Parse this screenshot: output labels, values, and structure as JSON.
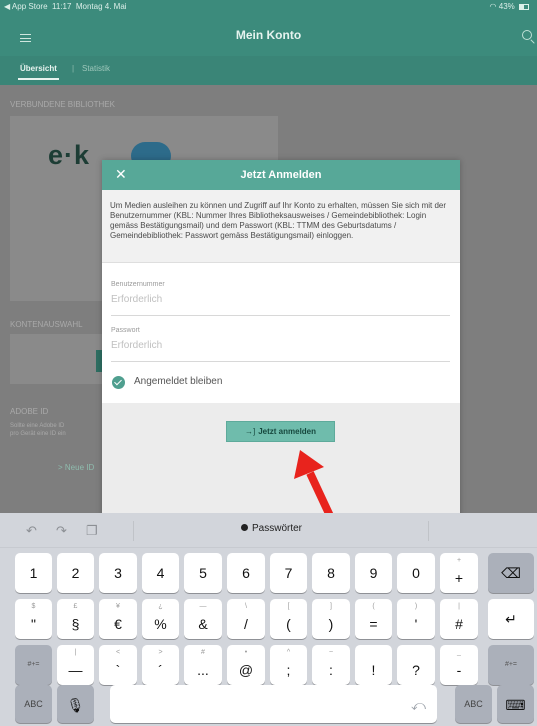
{
  "status": {
    "back_app": "◀ App Store",
    "time": "11:17",
    "date": "Montag 4. Mai",
    "battery": "43%"
  },
  "nav": {
    "title": "Mein Konto"
  },
  "tabs": [
    {
      "label": "Übersicht"
    },
    {
      "label": "Statistik"
    }
  ],
  "background": {
    "section_library": "VERBUNDENE BIBLIOTHEK",
    "logo_text": "e·k",
    "section_account": "KONTENAUSWAHL",
    "section_adobe": "ADOBE ID",
    "adobe_text_1": "Sollte eine Adobe ID",
    "adobe_text_2": "pro Gerät eine ID ein",
    "new_id_link": "> Neue ID"
  },
  "dialog": {
    "title": "Jetzt Anmelden",
    "close_icon": "✕",
    "info": "Um Medien ausleihen zu können und Zugriff auf Ihr Konto zu erhalten, müssen Sie sich mit der Benutzernummer (KBL: Nummer Ihres Bibliotheksausweises / Gemeindebibliothek: Login gemäss Bestätigungsmail) und dem Passwort (KBL: TTMM des Geburtsdatums / Gemeindebibliothek: Passwort gemäss Bestätigungsmail) einloggen.",
    "user_label": "Benutzernummer",
    "user_placeholder": "Erforderlich",
    "password_label": "Passwort",
    "password_placeholder": "Erforderlich",
    "remember_label": "Angemeldet bleiben",
    "remember_checked": true,
    "login_button": "Jetzt anmelden",
    "login_icon": "→]"
  },
  "keyboard": {
    "passwords_label": "Passwörter",
    "row1": [
      {
        "main": "1"
      },
      {
        "main": "2"
      },
      {
        "main": "3"
      },
      {
        "main": "4"
      },
      {
        "main": "5"
      },
      {
        "main": "6"
      },
      {
        "main": "7"
      },
      {
        "main": "8"
      },
      {
        "main": "9"
      },
      {
        "main": "0"
      },
      {
        "sub": "+",
        "main": "+"
      }
    ],
    "row2": [
      {
        "sub": "$",
        "main": "\""
      },
      {
        "sub": "£",
        "main": "§"
      },
      {
        "sub": "¥",
        "main": "€"
      },
      {
        "sub": "¿",
        "main": "%"
      },
      {
        "sub": "—",
        "main": "&"
      },
      {
        "sub": "\\",
        "main": "/"
      },
      {
        "sub": "[",
        "main": "("
      },
      {
        "sub": "]",
        "main": ")"
      },
      {
        "sub": "(",
        "main": "="
      },
      {
        "sub": ")",
        "main": "'"
      },
      {
        "sub": "|",
        "main": "#"
      }
    ],
    "row3": [
      {
        "sub": "|",
        "main": "—"
      },
      {
        "sub": "<",
        "main": "`"
      },
      {
        "sub": ">",
        "main": "´"
      },
      {
        "sub": "#",
        "main": "..."
      },
      {
        "sub": "•",
        "main": "@"
      },
      {
        "sub": "^",
        "main": ";"
      },
      {
        "sub": "~",
        "main": ":"
      },
      {
        "sub": "",
        "main": "!"
      },
      {
        "sub": "",
        "main": "?"
      },
      {
        "sub": "_",
        "main": "-"
      }
    ],
    "symbols_key": "#+=",
    "abc_key": "ABC"
  }
}
